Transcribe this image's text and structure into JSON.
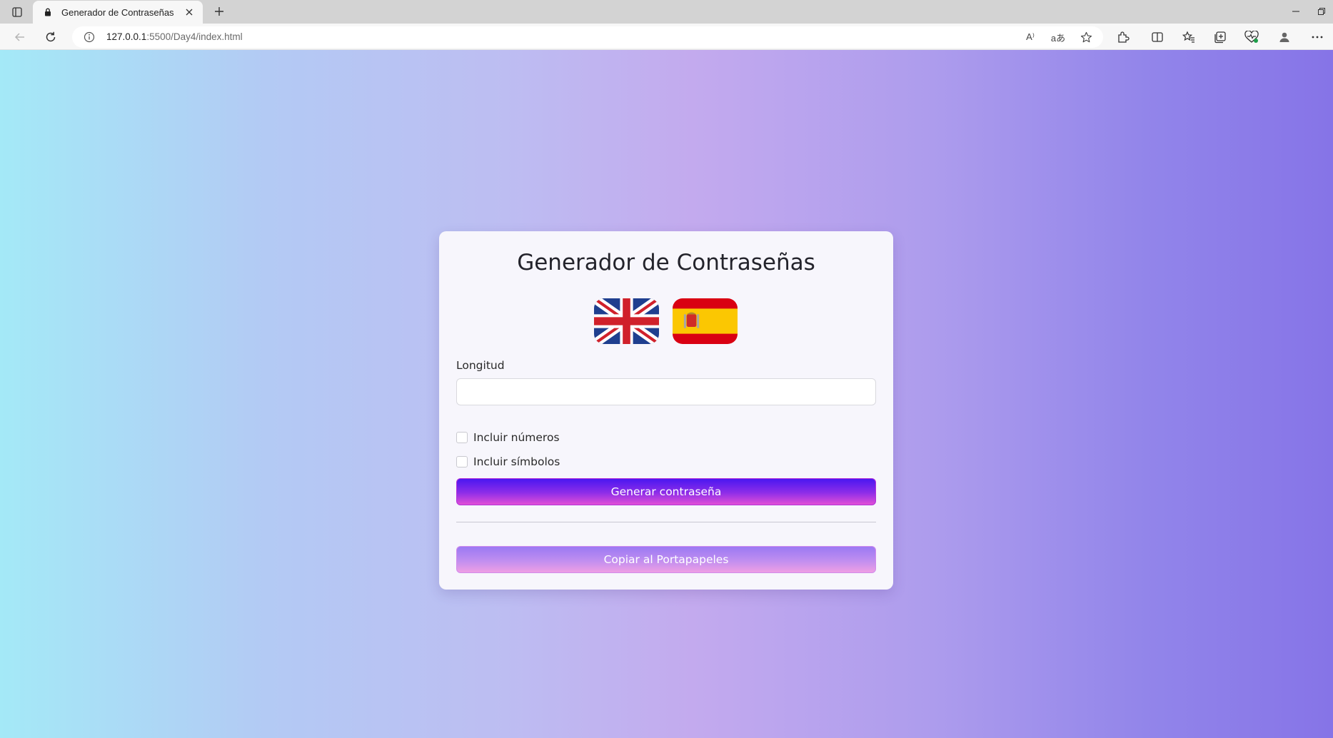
{
  "browser": {
    "tab_title": "Generador de Contraseñas",
    "url_host": "127.0.0.1",
    "url_rest": ":5500/Day4/index.html",
    "icons": [
      "sidebar-icon",
      "lock-icon",
      "close-icon",
      "plus-icon",
      "minimize-icon",
      "restore-icon",
      "back-icon",
      "refresh-icon",
      "info-icon",
      "read-aloud-icon",
      "translate-icon",
      "favorite-star-icon",
      "extensions-icon",
      "split-screen-icon",
      "favorites-icon",
      "collections-icon",
      "browser-essentials-icon",
      "profile-icon",
      "more-icon"
    ],
    "read_aloud_label": "A⁾",
    "translate_label": "aあ"
  },
  "app": {
    "title": "Generador de Contraseñas",
    "flags": [
      "uk-flag",
      "spain-flag"
    ],
    "length_label": "Longitud",
    "length_value": "",
    "include_numbers_label": "Incluir números",
    "include_symbols_label": "Incluir símbolos",
    "generate_button": "Generar contraseña",
    "copy_button": "Copiar al Portapapeles"
  },
  "colors": {
    "generate_button": "#5a1ff0",
    "copy_button": "#b58cf1",
    "background_left": "#a4e9f7",
    "background_right": "#8674e7"
  }
}
